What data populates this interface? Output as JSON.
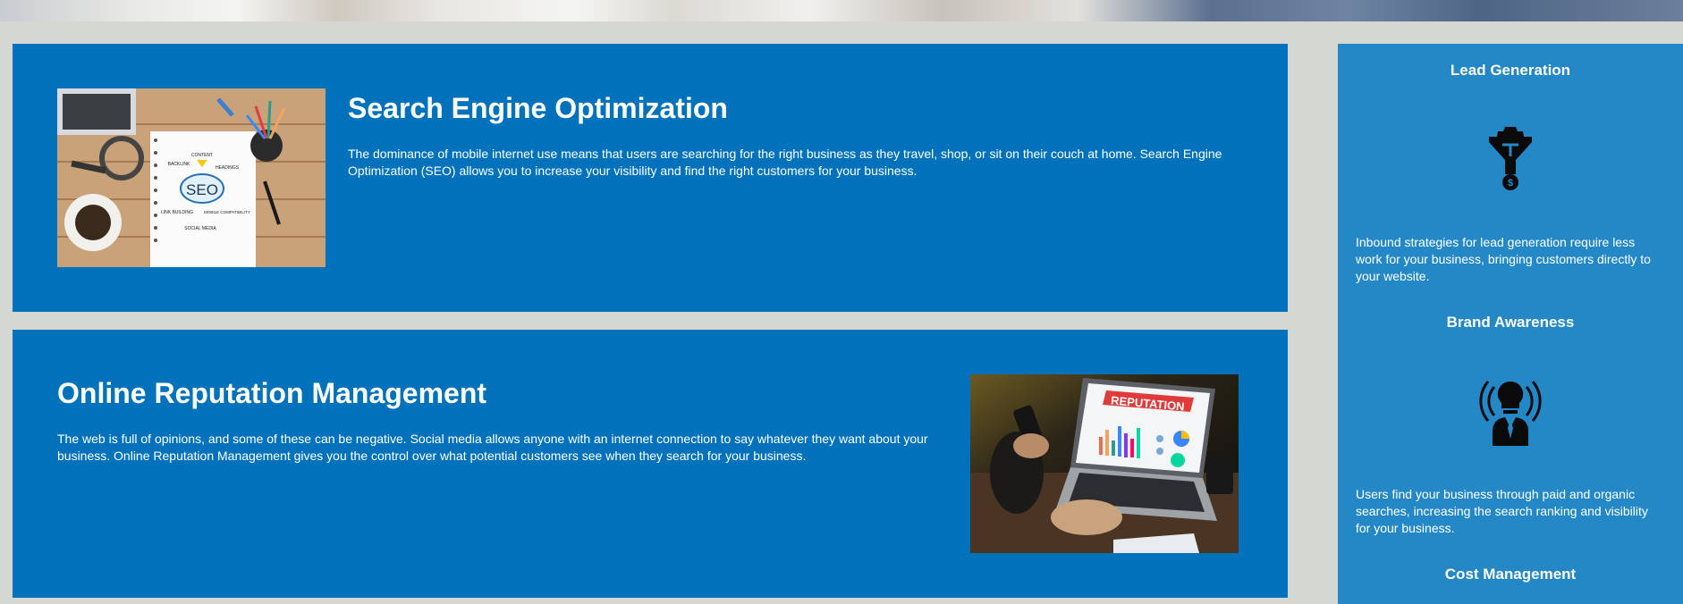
{
  "sections": [
    {
      "title": "Search Engine Optimization",
      "text": "The dominance of mobile internet use means that users are searching for the right business as they travel, shop, or sit on their couch at home. Search Engine Optimization (SEO) allows you to increase your visibility and find the right customers for your business.",
      "image": {
        "seo_text": "SEO",
        "labels": [
          "CONTENT",
          "BACKLINK",
          "HEADINGS",
          "LINK BUILDING",
          "MOBILE COMPATIBILITY",
          "SOCIAL MEDIA"
        ]
      }
    },
    {
      "title": "Online Reputation Management",
      "text": "The web is full of opinions, and some of these can be negative. Social media allows anyone with an internet connection to say whatever they want about your business. Online Reputation Management gives you the control over what potential customers see when they search for your business.",
      "image": {
        "banner_text": "REPUTATION"
      }
    }
  ],
  "benefits": [
    {
      "title": "Lead Generation",
      "icon": "funnel-gear-dollar-icon",
      "text": "Inbound strategies for lead generation require less work for your business, bringing customers directly to your website."
    },
    {
      "title": "Brand Awareness",
      "icon": "lightbulb-person-broadcast-icon",
      "text": "Users find your business through paid and organic searches, increasing the search ranking and visibility for your business."
    },
    {
      "title": "Cost Management"
    }
  ],
  "colors": {
    "page_background": "#d5d7d3",
    "section_background": "#0072bc",
    "sidebar_background": "#2488c6",
    "text": "#ffffff"
  }
}
